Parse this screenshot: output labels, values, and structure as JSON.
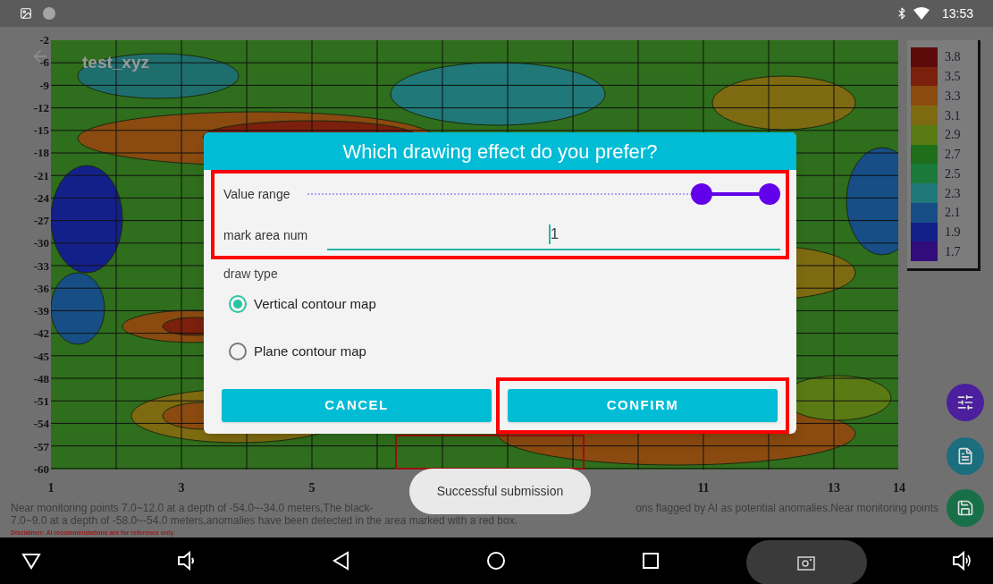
{
  "status_bar": {
    "time": "13:53"
  },
  "app_bar": {
    "title": "test_xyz"
  },
  "contour_map": {
    "y_axis": [
      "-2",
      "-6",
      "-9",
      "-12",
      "-15",
      "-18",
      "-21",
      "-24",
      "-27",
      "-30",
      "-33",
      "-36",
      "-39",
      "-42",
      "-45",
      "-48",
      "-51",
      "-54",
      "-57",
      "-60"
    ],
    "x_axis": [
      "1",
      "3",
      "5",
      "11",
      "13",
      "14"
    ],
    "legend": [
      {
        "label": "3.8",
        "color": "#5c0a0a"
      },
      {
        "label": "3.5",
        "color": "#7a200c"
      },
      {
        "label": "3.3",
        "color": "#8a4a10"
      },
      {
        "label": "3.1",
        "color": "#7e6a10"
      },
      {
        "label": "2.9",
        "color": "#5a7a14"
      },
      {
        "label": "2.7",
        "color": "#1f6e1a"
      },
      {
        "label": "2.5",
        "color": "#1a7a3a"
      },
      {
        "label": "2.3",
        "color": "#207878"
      },
      {
        "label": "2.1",
        "color": "#174e86"
      },
      {
        "label": "1.9",
        "color": "#14208a"
      },
      {
        "label": "1.7",
        "color": "#320c7a"
      }
    ]
  },
  "caption": {
    "line_1_start": "Near monitoring points 7.0~12.0 at a depth of -54.0~-34.0 meters,The black-",
    "line_1_end": "ons flagged by AI as potential anomalies.Near monitoring points",
    "line_2": "7.0~9.0 at a depth of -58.0~-54.0 meters,anomalies have been detected in the area marked with a red box.",
    "disclaimer": "Disclaimer: AI recommendations are for reference only."
  },
  "dialog": {
    "title": "Which drawing effect do you prefer?",
    "settings_highlighted": true,
    "value_range": {
      "label": "Value range",
      "thumbs": [
        {
          "level": 0.85
        },
        {
          "level": 1
        }
      ]
    },
    "mark_area": {
      "label": "mark area num",
      "value": "1"
    },
    "draw_type": {
      "label": "draw type",
      "options": [
        {
          "label": "Vertical contour map",
          "selected": true
        },
        {
          "label": "Plane contour map",
          "selected": false
        }
      ]
    },
    "buttons": [
      {
        "label": "CANCEL",
        "highlighted": false
      },
      {
        "label": "CONFIRM",
        "highlighted": true
      }
    ]
  },
  "toast": {
    "text": "Successful submission"
  }
}
